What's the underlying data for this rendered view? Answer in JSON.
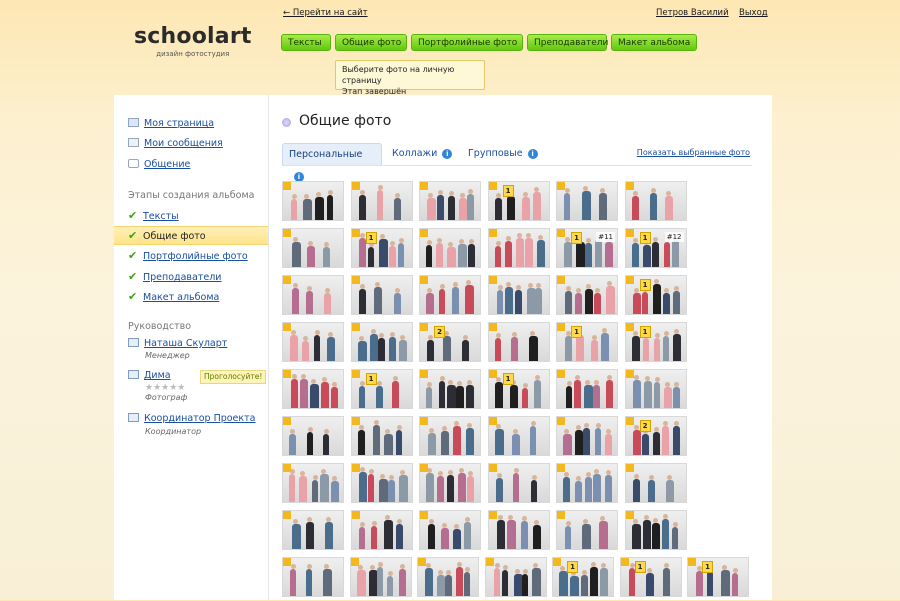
{
  "header": {
    "logo_title": "schoolart",
    "logo_subtitle": "дизайн фотостудия",
    "back_link": "← Перейти на сайт",
    "user_name": "Петров Василий",
    "logout": "Выход"
  },
  "nav": [
    "Тексты",
    "Общие фото",
    "Портфолийные фото",
    "Преподаватели",
    "Макет альбома"
  ],
  "tooltip": {
    "line1": "Выберите фото на личную страницу",
    "line2": "Этап завершён"
  },
  "sidebar": {
    "links": [
      "Моя страница",
      "Мои сообщения",
      "Общение"
    ],
    "stages_heading": "Этапы создания альбома",
    "stages": [
      "Тексты",
      "Общие фото",
      "Портфолийные фото",
      "Преподаватели",
      "Макет альбома"
    ],
    "management_heading": "Руководство",
    "people": [
      {
        "name": "Наташа Скуларт",
        "role": "Менеджер"
      },
      {
        "name": "Дима",
        "role": "Фотограф"
      },
      {
        "name": "Координатор Проекта",
        "role": "Координатор"
      }
    ],
    "vote_label": "Проголосуйте!",
    "stars": "★★★★★"
  },
  "main": {
    "title": "Общие фото",
    "tabs": [
      "Персональные",
      "Коллажи",
      "Групповые"
    ],
    "show_selected": "Показать выбранные фото",
    "info_glyph": "i"
  },
  "thumbnails": {
    "rows": [
      [
        "",
        "",
        "",
        "1",
        "",
        ""
      ],
      [
        "",
        "1",
        "",
        "",
        "#11|1",
        "#12|1"
      ],
      [
        "",
        "",
        "",
        "",
        "",
        "1"
      ],
      [
        "",
        "",
        "2",
        "",
        "1",
        "1"
      ],
      [
        "",
        "1",
        "",
        "1",
        "",
        ""
      ],
      [
        "",
        "",
        "",
        "",
        "",
        "2"
      ],
      [
        "",
        "",
        "",
        "",
        "",
        ""
      ],
      [
        "",
        "",
        "",
        "",
        "",
        ""
      ],
      [
        "",
        "",
        "",
        "",
        "1",
        "1",
        "1"
      ]
    ]
  },
  "colors": {
    "accent_green": "#63c70f",
    "link_blue": "#1a4fa0",
    "check_green": "#3aa40a",
    "badge_yellow": "#ffd94a"
  }
}
